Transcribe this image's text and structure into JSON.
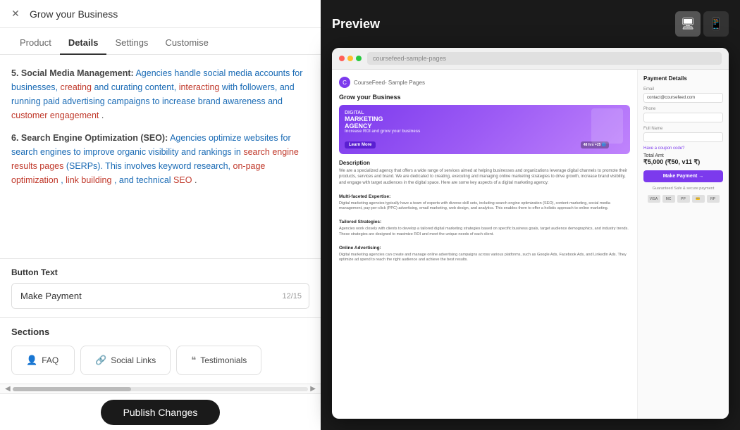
{
  "app": {
    "title": "Grow your Business",
    "close_icon": "✕"
  },
  "tabs": [
    {
      "id": "product",
      "label": "Product",
      "active": false
    },
    {
      "id": "details",
      "label": "Details",
      "active": true
    },
    {
      "id": "settings",
      "label": "Settings",
      "active": false
    },
    {
      "id": "customise",
      "label": "Customise",
      "active": false
    }
  ],
  "editor": {
    "content_paragraphs": [
      {
        "number": "5.",
        "bold_title": "Social Media Management:",
        "text": " Agencies handle social media accounts for businesses, creating and curating content, interacting with followers, and running paid advertising campaigns to increase brand awareness and customer engagement."
      },
      {
        "number": "6.",
        "bold_title": "Search Engine Optimization (SEO):",
        "text": " Agencies optimize websites for search engines to improve organic visibility and rankings in search engine results pages (SERPs). This involves keyword research, on-page optimization, link building, and technical SEO."
      }
    ],
    "button_text_label": "Button Text",
    "button_text_value": "Make Payment",
    "button_text_char_count": "12/15",
    "sections_title": "Sections",
    "sections": [
      {
        "id": "faq",
        "icon": "👤",
        "label": "FAQ"
      },
      {
        "id": "social-links",
        "icon": "🔗",
        "label": "Social Links"
      },
      {
        "id": "testimonials",
        "icon": "❝",
        "label": "Testimonials"
      }
    ]
  },
  "publish_button_label": "Publish Changes",
  "preview": {
    "title": "Preview",
    "address": "coursefeed-sample-pages",
    "desktop_icon": "🖥",
    "mobile_icon": "📱",
    "page": {
      "brand": "CourseFeed- Sample Pages",
      "hero_title": "Grow your Business",
      "hero_subtitle": "DIGITAL MARKETING AGENCY",
      "hero_description": "Increase ROI and grow your business",
      "hero_cta": "Learn More",
      "hero_badge": "🕐 48 hrs, +25 🌐",
      "description_title": "Description",
      "description_text": "We are a specialized agency that offers a wide range of services aimed at helping businesses and organizations leverage digital channels to promote their products, services and brand. We are dedicated to creating, executing and managing online marketing strategies to drive growth, increase brand visibility, and engage with target audiences in the digital space. Here are some key aspects of a digital marketing agency:",
      "features": [
        {
          "title": "Multi-faceted Expertise:",
          "text": "Digital marketing agencies typically have a team of experts with diverse skill sets, including search engine optimization (SEO), content marketing, social media management, pay-per-click (PPC) advertising, email marketing, web design, and analytics. This enables them to offer a holistic approach to online marketing."
        },
        {
          "title": "Tailored Strategies:",
          "text": "Agencies work closely with clients to develop a tailored digital marketing strategies based on specific business goals, target audience demographics, and industry trends. These strategies are designed to maximize ROI and meet the unique needs of each client."
        },
        {
          "title": "Online Advertising:",
          "text": "Digital marketing agencies can create and manage online advertising campaigns across various platforms, such as Google Ads, Facebook Ads, and LinkedIn Ads. They optimize ad spend to reach the right audience and achieve the best results."
        }
      ],
      "payment": {
        "title": "Payment Details",
        "email_label": "Email",
        "email_value": "contact@coursefeed.com",
        "phone_label": "Phone",
        "full_name_label": "Full Name",
        "coupon_label": "Have a coupon code?",
        "total_label": "Total Amt",
        "total_value": "₹5,000 (₹50, v11 ₹)",
        "pay_button": "Make Payment →",
        "guaranteed_text": "Guaranteed Safe & secure payment",
        "payment_methods": [
          "VISA",
          "MC",
          "PayP",
          "💳",
          "RuPay"
        ]
      }
    }
  }
}
